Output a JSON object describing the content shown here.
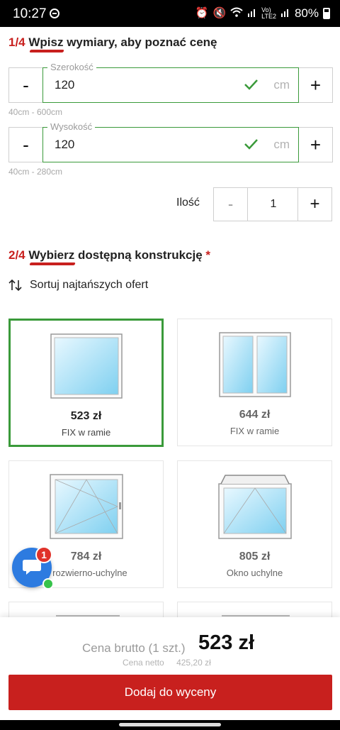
{
  "status_bar": {
    "time": "10:27",
    "battery": "80%",
    "icons": [
      "alarm-icon",
      "mute-icon",
      "wifi-icon",
      "signal-icon",
      "volte-icon",
      "signal-icon",
      "battery-icon"
    ]
  },
  "step1": {
    "number": "1/4",
    "title": "Wpisz wymiary, aby poznać cenę"
  },
  "width_field": {
    "label": "Szerokość",
    "value": "120",
    "unit": "cm",
    "range": "40cm - 600cm",
    "minus": "-",
    "plus": "+"
  },
  "height_field": {
    "label": "Wysokość",
    "value": "120",
    "unit": "cm",
    "range": "40cm - 280cm",
    "minus": "-",
    "plus": "+"
  },
  "quantity": {
    "label": "Ilość",
    "value": "1",
    "minus": "-",
    "plus": "+"
  },
  "step2": {
    "number": "2/4",
    "title": "Wybierz dostępną konstrukcję",
    "required_mark": "*"
  },
  "sort": {
    "label": "Sortuj najtańszych ofert"
  },
  "products": [
    {
      "price": "523 zł",
      "name": "FIX w ramie",
      "selected": true
    },
    {
      "price": "644 zł",
      "name": "FIX w ramie",
      "selected": false
    },
    {
      "price": "784 zł",
      "name": "o rozwierno-uchylne",
      "selected": false
    },
    {
      "price": "805 zł",
      "name": "Okno uchylne",
      "selected": false
    }
  ],
  "chat": {
    "badge": "1"
  },
  "summary": {
    "gross_label": "Cena brutto (1 szt.)",
    "gross_value": "523 zł",
    "net_label": "Cena netto",
    "net_value": "425,20 zł",
    "button": "Dodaj do wyceny"
  },
  "colors": {
    "accent_red": "#c8201e",
    "success_green": "#3a9a3a",
    "chat_blue": "#2d7be0"
  }
}
